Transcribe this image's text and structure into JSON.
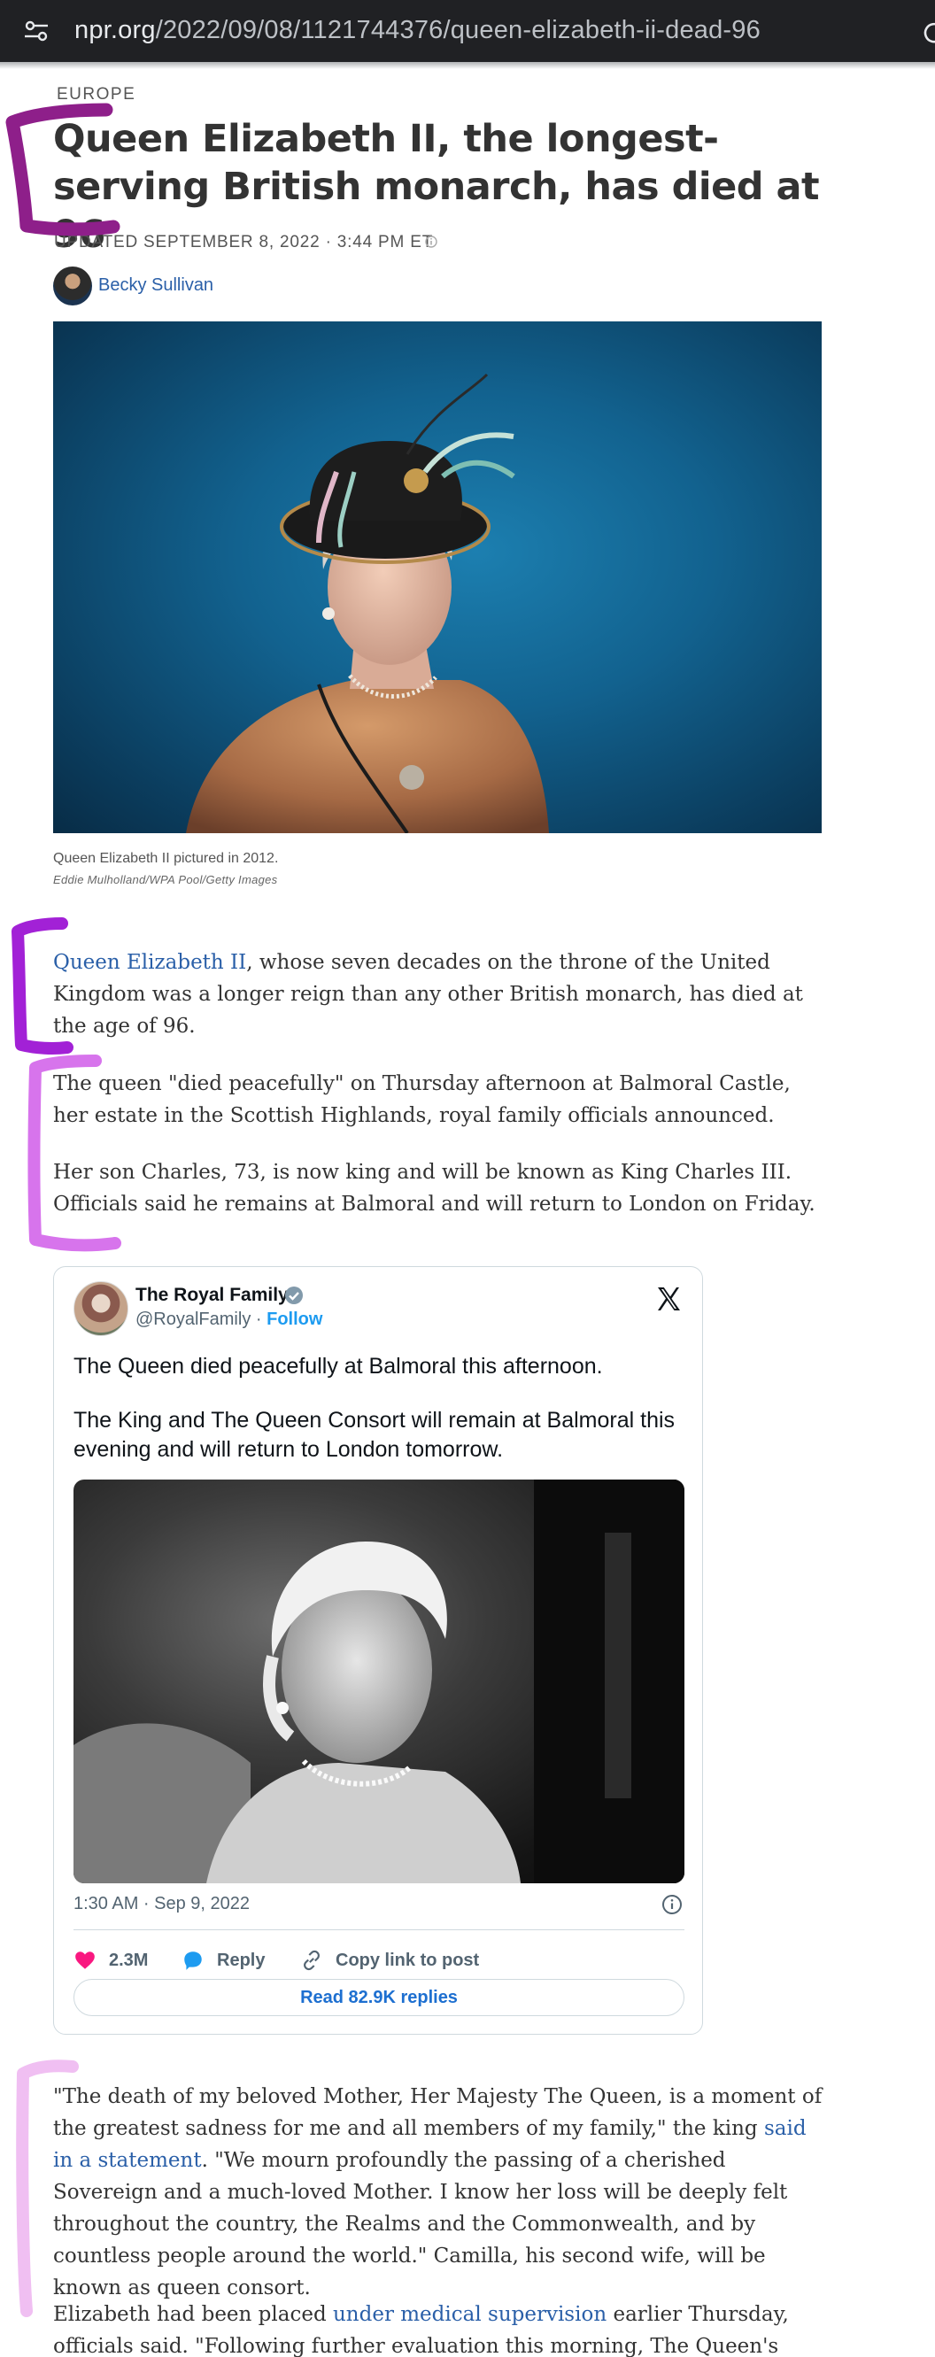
{
  "browser": {
    "url_host": "npr.org",
    "url_path": "/2022/09/08/1121744376/queen-elizabeth-ii-dead-96"
  },
  "article": {
    "section": "EUROPE",
    "headline": "Queen Elizabeth II, the longest-serving British monarch, has died at 96",
    "updated": "UPDATED SEPTEMBER 8, 2022 · 3:44 PM ET",
    "author": "Becky Sullivan",
    "photo_caption": "Queen Elizabeth II pictured in 2012.",
    "photo_credit": "Eddie Mulholland/WPA Pool/Getty Images",
    "p1_link": "Queen Elizabeth II",
    "p1_rest": ", whose seven decades on the throne of the United Kingdom was a longer reign than any other British monarch, has died at the age of 96.",
    "p2": "The queen \"died peacefully\" on Thursday afternoon at Balmoral Castle, her estate in the Scottish Highlands, royal family officials announced.",
    "p3": "Her son Charles, 73, is now king and will be known as King Charles III. Officials said he remains at Balmoral and will return to London on Friday.",
    "p4_a": "\"The death of my beloved Mother, Her Majesty The Queen, is a moment of the greatest sadness for me and all members of my family,\" the king ",
    "p4_link": "said in a statement",
    "p4_b": ". \"We mourn profoundly the passing of a cherished Sovereign and a much-loved Mother. I know her loss will be deeply felt throughout the country, the Realms and the Commonwealth, and by countless people around the world.\" Camilla, his second wife, will be known as queen consort.",
    "p5_a": "Elizabeth had been placed ",
    "p5_link": "under medical supervision",
    "p5_b": " earlier Thursday, officials said. \"Following further evaluation this morning, The Queen's doctors"
  },
  "tweet": {
    "name": "The Royal Family",
    "handle": "@RoyalFamily",
    "separator": " · ",
    "follow": "Follow",
    "text_1": "The Queen died peacefully at Balmoral this afternoon.",
    "text_2": "The King and The Queen Consort will remain at Balmoral this evening and will return to London tomorrow.",
    "timestamp": "1:30 AM · Sep 9, 2022",
    "likes": "2.3M",
    "reply": "Reply",
    "copy_link": "Copy link to post",
    "read_replies": "Read 82.9K replies"
  },
  "colors": {
    "link": "#2a5fa8",
    "bracket_1": "#8e1f8a",
    "bracket_2": "#a221d6",
    "bracket_3": "#d774ec",
    "bracket_4": "#f0bff2"
  },
  "icons": [
    "site-settings-icon",
    "reload-icon",
    "info-icon",
    "verified-badge-icon",
    "x-logo-icon",
    "heart-icon",
    "reply-icon",
    "link-icon"
  ]
}
